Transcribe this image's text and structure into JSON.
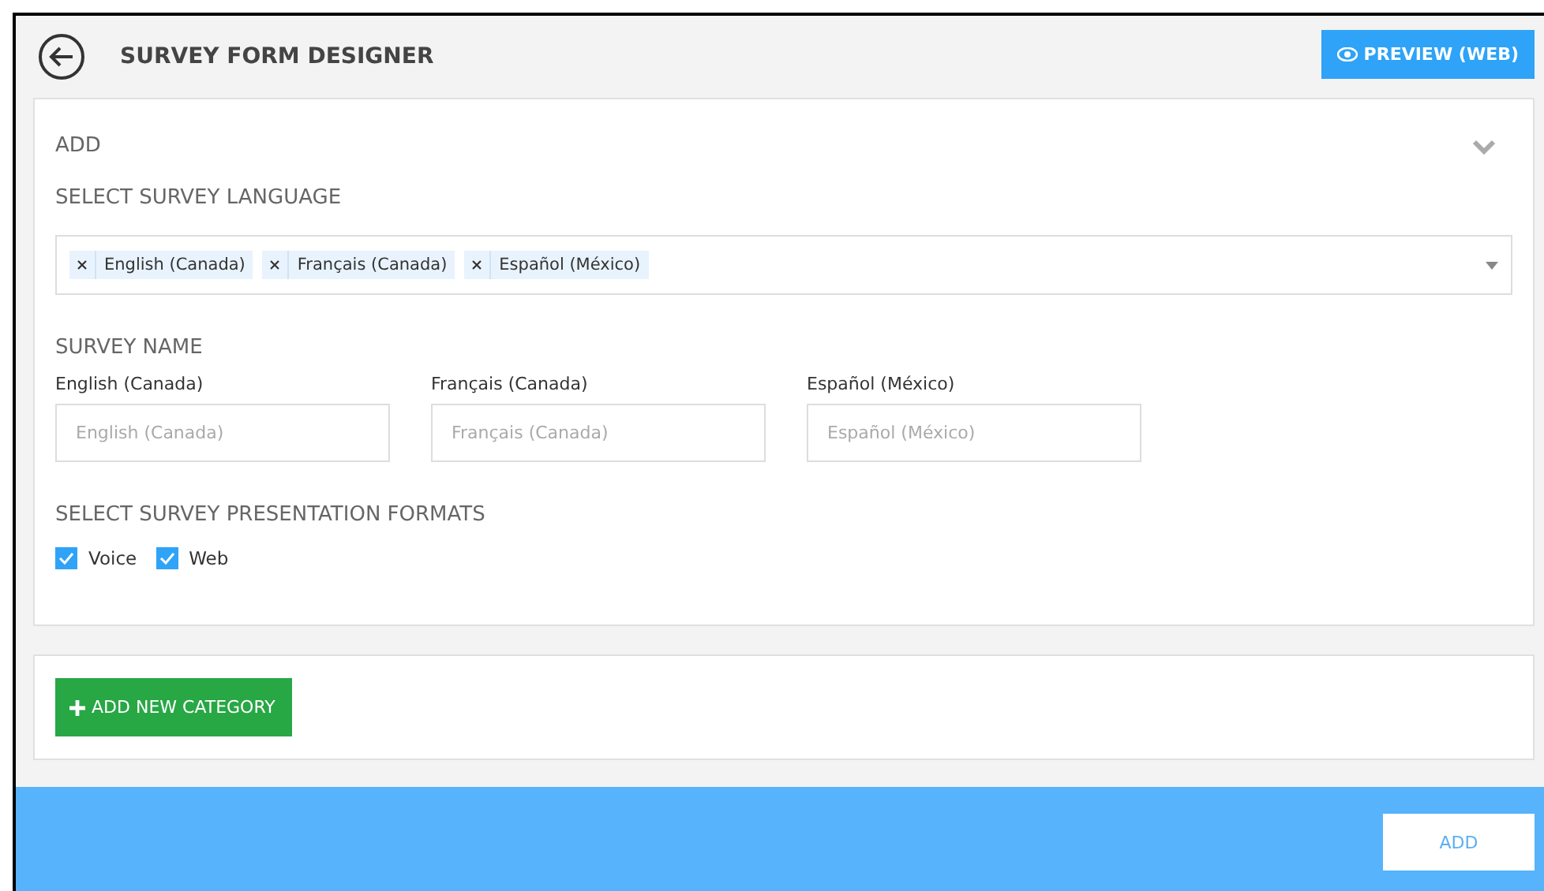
{
  "header": {
    "title": "SURVEY FORM DESIGNER",
    "preview_button": "PREVIEW (WEB)"
  },
  "section": {
    "title": "ADD",
    "expanded": true,
    "language_label": "SELECT SURVEY LANGUAGE",
    "languages": [
      "English (Canada)",
      "Français (Canada)",
      "Español (México)"
    ],
    "name_label": "SURVEY NAME",
    "name_fields": [
      {
        "label": "English (Canada)",
        "placeholder": "English (Canada)"
      },
      {
        "label": "Français (Canada)",
        "placeholder": "Français (Canada)"
      },
      {
        "label": "Español (México)",
        "placeholder": "Español (México)"
      }
    ],
    "formats_label": "SELECT SURVEY PRESENTATION FORMATS",
    "formats": [
      {
        "label": "Voice",
        "checked": true
      },
      {
        "label": "Web",
        "checked": true
      }
    ]
  },
  "add_category_button": "ADD NEW CATEGORY",
  "footer": {
    "add_button": "ADD"
  }
}
